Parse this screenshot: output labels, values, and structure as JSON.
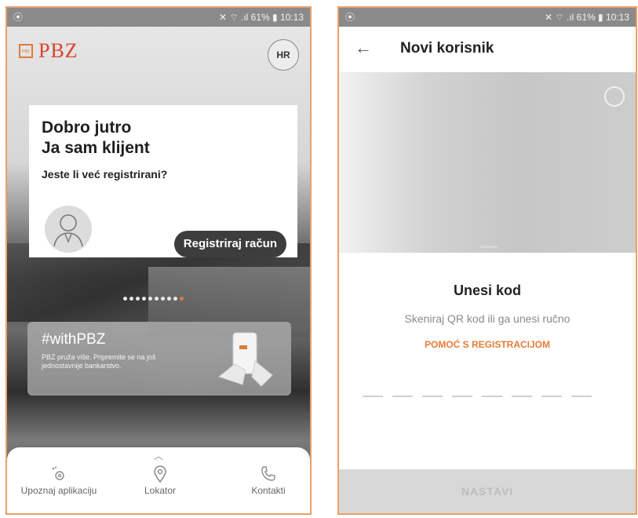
{
  "left_screen": {
    "statusbar": {
      "left_glyph": "⦿",
      "right_text": "✕ ⌔ .ıl 61% ▮ 10:13"
    },
    "logo_text": "PBZ",
    "logo_mark": "PBZ",
    "language_button": "HR",
    "card": {
      "greeting_line1": "Dobro jutro",
      "greeting_line2": "Ja sam klijent",
      "question": "Jeste li već registrirani?",
      "register_button": "Registriraj račun"
    },
    "pager": {
      "count": 10,
      "active_index": 9
    },
    "promo": {
      "title": "#withPBZ",
      "text": "PBZ pruža više. Pripremite se na još jednostavnije bankarstvo."
    },
    "bottom_nav": {
      "items": [
        {
          "label": "Upoznaj aplikaciju",
          "icon": "gear-sparkle-icon"
        },
        {
          "label": "Lokator",
          "icon": "location-pin-icon"
        },
        {
          "label": "Kontakti",
          "icon": "phone-icon"
        }
      ]
    }
  },
  "right_screen": {
    "statusbar": {
      "left_glyph": "⦿",
      "right_text": "✕ ⌔ .ıl 61% ▮ 10:13"
    },
    "back_icon": "←",
    "title": "Novi korisnik",
    "code_title": "Unesi kod",
    "code_subtitle": "Skeniraj QR kod ili ga unesi ručno",
    "help_link": "POMOĆ S REGISTRACIJOM",
    "code_field_count": 8,
    "continue_button": "NASTAVI"
  },
  "colors": {
    "accent": "#e67b35",
    "logo_red": "#d8422e",
    "register_button_bg": "#3d3d3d",
    "frame_border": "#e8a06a"
  }
}
